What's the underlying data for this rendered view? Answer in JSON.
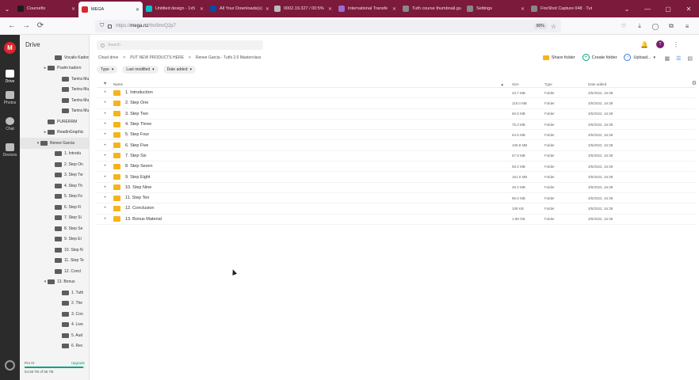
{
  "browser": {
    "tabs": [
      {
        "label": "Coursefix",
        "color": "#1c1c1c"
      },
      {
        "label": "MEGA",
        "color": "#d9272e",
        "active": true
      },
      {
        "label": "Untitled design - 1x5",
        "color": "#00c4cc"
      },
      {
        "label": "All Your Downloads(s)",
        "color": "#0a4ba6"
      },
      {
        "label": "0002.19.327 / 00:5%",
        "color": "#bbbbbb"
      },
      {
        "label": "International Transfe",
        "color": "#9b6bd1"
      },
      {
        "label": "Tuth course thumbnail.gu",
        "color": "#888888"
      },
      {
        "label": "Settings",
        "color": "#888888"
      },
      {
        "label": "FireShot Capture 048 · Tuth",
        "color": "#888888"
      }
    ],
    "url_prefix": "https://",
    "url_domain": "mega.nz",
    "url_path": "/fm/9m/Q2p7",
    "zoom": "80%",
    "icons": {
      "back": "←",
      "forward": "→",
      "reload": "⟳",
      "shield": "⛉",
      "lock": "🔒",
      "star": "☆",
      "download": "⤓",
      "account": "◯",
      "extensions": "⧉",
      "menu": "≡",
      "minimize": "—",
      "maximize": "▢",
      "close": "✕",
      "tablist": "⌄"
    }
  },
  "rail": {
    "logo": "M",
    "items": [
      {
        "label": "Drive",
        "selected": true
      },
      {
        "label": "Photos"
      },
      {
        "label": "Chat"
      },
      {
        "label": "Devices"
      }
    ]
  },
  "sidebar": {
    "title": "Drive",
    "tree": [
      {
        "label": "Vocalis Kadoo",
        "level": 2,
        "arrow": ""
      },
      {
        "label": "Psalm kadoro",
        "level": 1,
        "arrow": "▸"
      },
      {
        "label": "Tantra Mu",
        "level": 3,
        "arrow": ""
      },
      {
        "label": "Tantra Mu",
        "level": 3,
        "arrow": ""
      },
      {
        "label": "Tantra Mu",
        "level": 3,
        "arrow": ""
      },
      {
        "label": "Tantra Mu",
        "level": 3,
        "arrow": ""
      },
      {
        "label": "PURERRM",
        "level": 1,
        "arrow": ""
      },
      {
        "label": "ReadinGraphic",
        "level": 1,
        "arrow": "▸"
      },
      {
        "label": "Renee Garcia",
        "level": 0,
        "arrow": "▾",
        "selected": true
      },
      {
        "label": "1. Introdu",
        "level": 2,
        "arrow": ""
      },
      {
        "label": "2. Step On",
        "level": 2,
        "arrow": ""
      },
      {
        "label": "3. Step Tw",
        "level": 2,
        "arrow": ""
      },
      {
        "label": "4. Step Th",
        "level": 2,
        "arrow": ""
      },
      {
        "label": "5. Step Fo",
        "level": 2,
        "arrow": ""
      },
      {
        "label": "6. Step Fi",
        "level": 2,
        "arrow": ""
      },
      {
        "label": "7. Step Si",
        "level": 2,
        "arrow": ""
      },
      {
        "label": "8. Step Se",
        "level": 2,
        "arrow": ""
      },
      {
        "label": "9. Step Ei",
        "level": 2,
        "arrow": ""
      },
      {
        "label": "10. Step N",
        "level": 2,
        "arrow": ""
      },
      {
        "label": "11. Step Te",
        "level": 2,
        "arrow": ""
      },
      {
        "label": "12. Concl",
        "level": 2,
        "arrow": ""
      },
      {
        "label": "13. Bonus",
        "level": 1,
        "arrow": "▾"
      },
      {
        "label": "1. Tuth",
        "level": 3,
        "arrow": ""
      },
      {
        "label": "2. The",
        "level": 3,
        "arrow": ""
      },
      {
        "label": "3. Con",
        "level": 3,
        "arrow": ""
      },
      {
        "label": "4. Live",
        "level": 3,
        "arrow": ""
      },
      {
        "label": "5. Aud",
        "level": 3,
        "arrow": ""
      },
      {
        "label": "6. Rec",
        "level": 3,
        "arrow": ""
      }
    ],
    "storage": {
      "plan": "Pro III",
      "upgrade": "Upgrade",
      "used": "54.65 TB of 56 TB",
      "fraction": 0.97
    }
  },
  "main": {
    "search_placeholder": "Search",
    "breadcrumb": [
      "Cloud drive",
      ">",
      "PUT NEW PRODUCTS HERE",
      ">",
      "Renee Garcia - Tuthi 2.0 Masterclass"
    ],
    "actions": {
      "share": "Share folder",
      "create": "Create folder",
      "upload": "Upload..."
    },
    "filters": [
      "Type",
      "Last modified",
      "Date added"
    ],
    "columns": {
      "name": "Name",
      "size": "Size",
      "type": "Type",
      "date": "Date added"
    },
    "rows": [
      {
        "name": "1. Introduction",
        "size": "43.7 MB",
        "type": "Folder",
        "date": "3/5/2022, 16:38"
      },
      {
        "name": "2. Step One",
        "size": "115.0 MB",
        "type": "Folder",
        "date": "3/5/2022, 16:38"
      },
      {
        "name": "3. Step Two",
        "size": "60.8 MB",
        "type": "Folder",
        "date": "3/5/2022, 16:38"
      },
      {
        "name": "4. Step Three",
        "size": "75.3 MB",
        "type": "Folder",
        "date": "3/5/2022, 16:38"
      },
      {
        "name": "5. Step Four",
        "size": "64.6 MB",
        "type": "Folder",
        "date": "3/5/2022, 16:38"
      },
      {
        "name": "6. Step Five",
        "size": "106.8 MB",
        "type": "Folder",
        "date": "3/5/2022, 16:38"
      },
      {
        "name": "7. Step Six",
        "size": "57.8 MB",
        "type": "Folder",
        "date": "3/5/2022, 16:38"
      },
      {
        "name": "8. Step Seven",
        "size": "58.2 MB",
        "type": "Folder",
        "date": "3/5/2022, 16:38"
      },
      {
        "name": "9. Step Eight",
        "size": "161.0 MB",
        "type": "Folder",
        "date": "3/5/2022, 16:38"
      },
      {
        "name": "10. Step Nine",
        "size": "48.2 MB",
        "type": "Folder",
        "date": "3/5/2022, 16:38"
      },
      {
        "name": "11. Step Ten",
        "size": "86.6 MB",
        "type": "Folder",
        "date": "3/5/2022, 16:38"
      },
      {
        "name": "12. Conclusion",
        "size": "108 KB",
        "type": "Folder",
        "date": "3/5/2022, 16:38"
      },
      {
        "name": "13. Bonus Material",
        "size": "1.98 GB",
        "type": "Folder",
        "date": "3/5/2022, 16:38"
      }
    ],
    "user_initial": "T"
  }
}
